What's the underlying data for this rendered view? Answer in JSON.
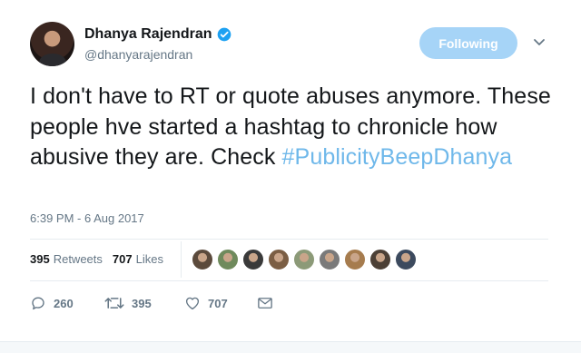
{
  "author": {
    "display_name": "Dhanya Rajendran",
    "handle": "@dhanyarajendran",
    "verified_icon": "verified-badge-icon",
    "verified_color": "#1da1f2"
  },
  "follow_button": {
    "label": "Following",
    "color": "#a6d4f7"
  },
  "menu": {
    "icon": "chevron-down-icon"
  },
  "tweet": {
    "text": "I don't have to RT or quote abuses anymore. These people hve started a hashtag to chronicle how abusive they are. Check ",
    "hashtag": "#PublicityBeepDhanya",
    "hashtag_color": "#6fb8ea"
  },
  "timestamp": "6:39 PM - 6 Aug 2017",
  "stats": {
    "retweets_count": "395",
    "retweets_label": "Retweets",
    "likes_count": "707",
    "likes_label": "Likes"
  },
  "liker_avatars": [
    {
      "color": "#5b4a3c"
    },
    {
      "color": "#6f8a5c"
    },
    {
      "color": "#3a3a3a"
    },
    {
      "color": "#7b5e44"
    },
    {
      "color": "#8c9a78"
    },
    {
      "color": "#7a7a7a"
    },
    {
      "color": "#a67c4e"
    },
    {
      "color": "#4c4036"
    },
    {
      "color": "#3c4a5e"
    }
  ],
  "actions": {
    "reply_count": "260",
    "retweet_count": "395",
    "like_count": "707",
    "reply_icon": "reply-icon",
    "retweet_icon": "retweet-icon",
    "like_icon": "heart-icon",
    "dm_icon": "envelope-icon"
  }
}
